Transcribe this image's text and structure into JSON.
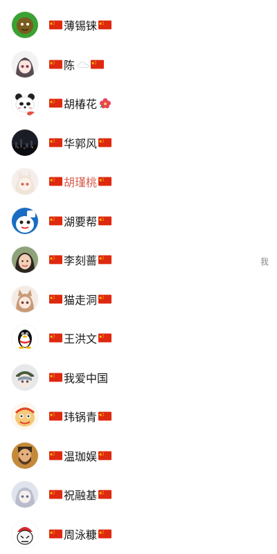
{
  "contacts": [
    {
      "name": "薄锡铼",
      "flag_before": true,
      "flag_after": true,
      "highlight": false,
      "avatar": "green-fruit-avatar"
    },
    {
      "name": "陈",
      "flag_before": true,
      "flag_after": true,
      "highlight": false,
      "emoji": "cloud-icon",
      "avatar": "anime-girl-avatar"
    },
    {
      "name": "胡椿花",
      "flag_before": true,
      "flag_after": false,
      "highlight": false,
      "emoji": "hibiscus-icon",
      "avatar": "panda-avatar"
    },
    {
      "name": "华郭风",
      "flag_before": true,
      "flag_after": true,
      "highlight": false,
      "avatar": "city-night-avatar"
    },
    {
      "name": "胡瑾桃",
      "flag_before": true,
      "flag_after": true,
      "highlight": true,
      "avatar": "anime-cat-girl-avatar"
    },
    {
      "name": "湖要帮",
      "flag_before": true,
      "flag_after": true,
      "highlight": false,
      "avatar": "cartoon-ghost-avatar"
    },
    {
      "name": "李刻蔷",
      "flag_before": true,
      "flag_after": true,
      "highlight": false,
      "avatar": "photo-woman-avatar"
    },
    {
      "name": "猫走洞",
      "flag_before": true,
      "flag_after": true,
      "highlight": false,
      "avatar": "anime-catgirl-avatar"
    },
    {
      "name": "王洪文",
      "flag_before": true,
      "flag_after": true,
      "highlight": false,
      "avatar": "qq-penguin-avatar"
    },
    {
      "name": "我爱中国",
      "flag_before": true,
      "flag_after": false,
      "highlight": false,
      "avatar": "soldier-anime-avatar"
    },
    {
      "name": "玮锅青",
      "flag_before": true,
      "flag_after": true,
      "highlight": false,
      "avatar": "lion-dance-avatar"
    },
    {
      "name": "温珈娱",
      "flag_before": true,
      "flag_after": true,
      "highlight": false,
      "avatar": "bearded-man-avatar"
    },
    {
      "name": "祝融基",
      "flag_before": true,
      "flag_after": true,
      "highlight": false,
      "avatar": "anime-silver-hair-avatar"
    },
    {
      "name": "周泳糠",
      "flag_before": true,
      "flag_after": true,
      "highlight": false,
      "avatar": "red-hat-figure-avatar"
    }
  ],
  "side_label": "我",
  "colors": {
    "flag_red": "#de2910",
    "flag_star": "#ffde00",
    "highlight_name": "#d65c4f"
  }
}
